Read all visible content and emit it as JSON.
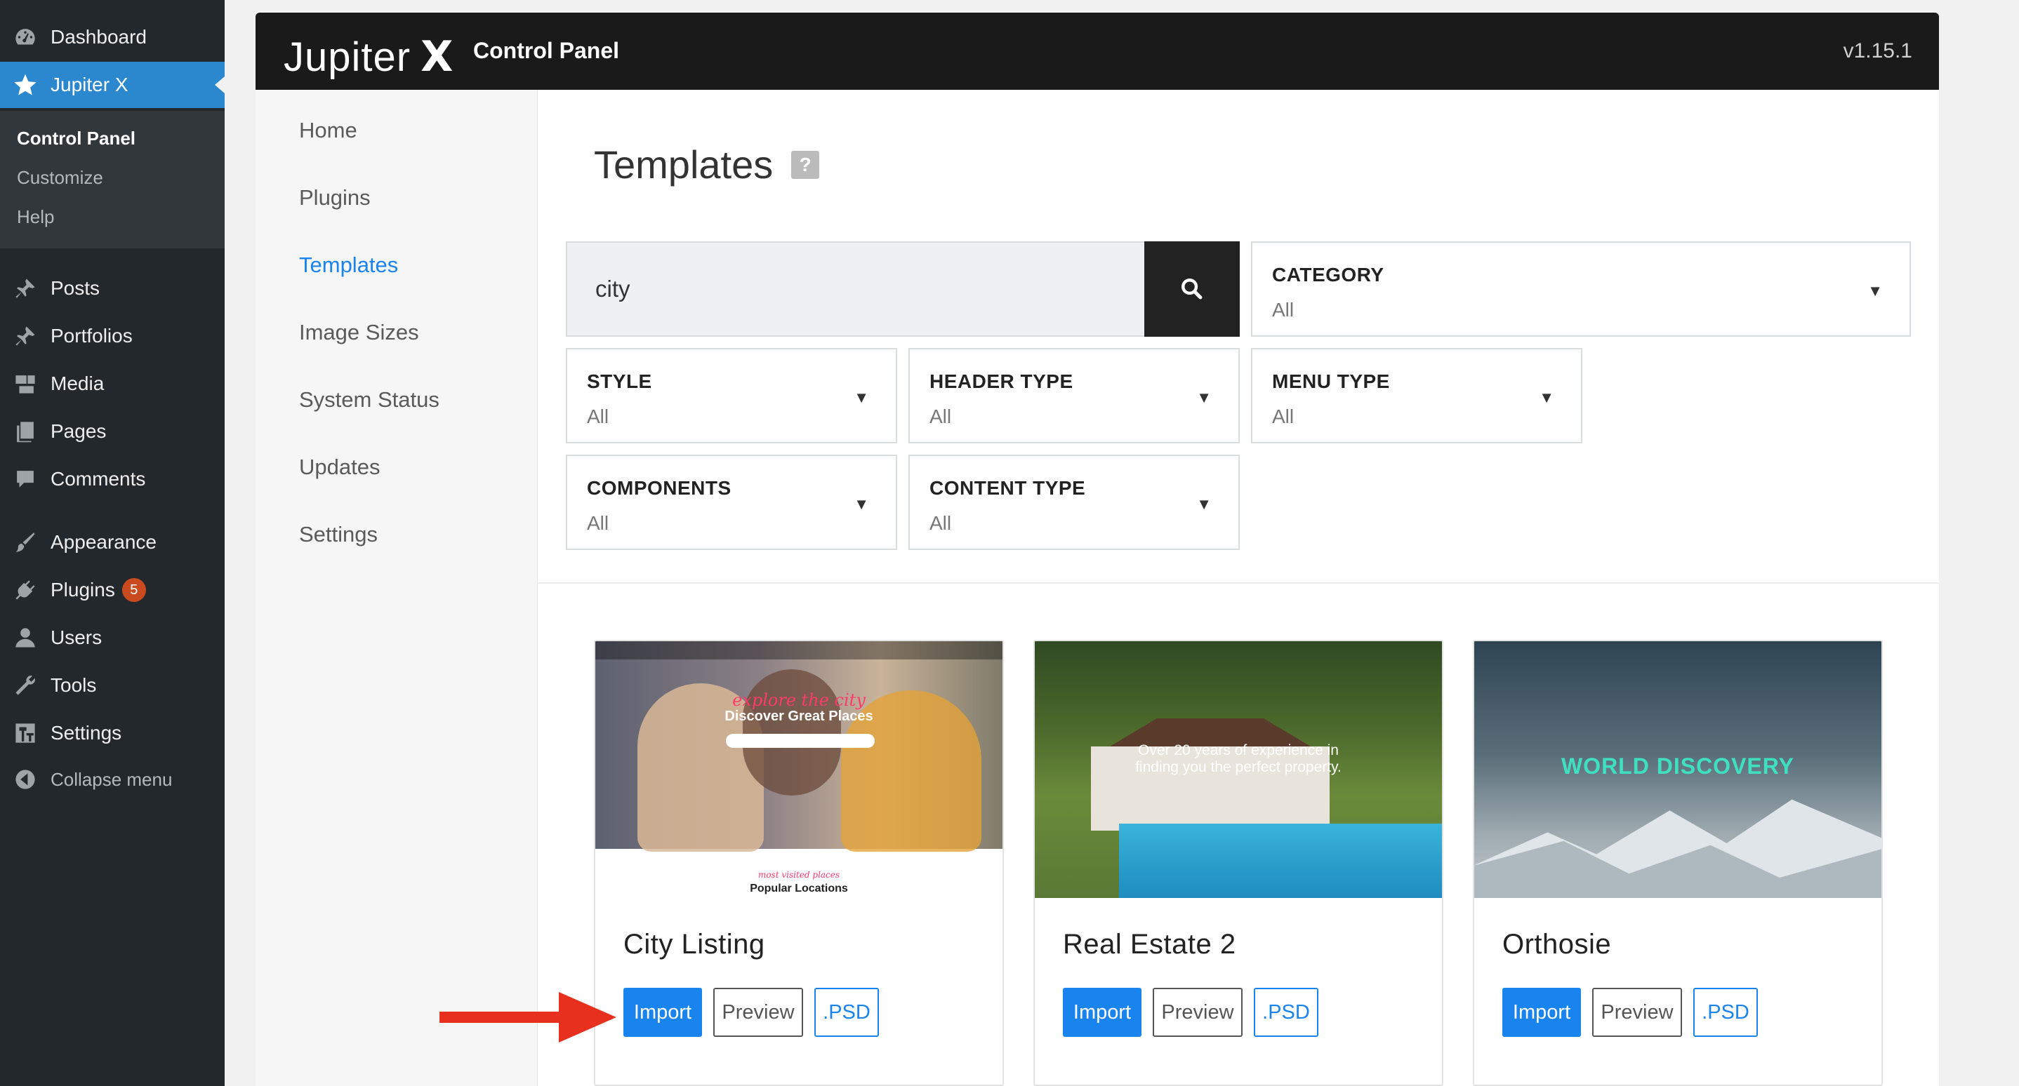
{
  "wp_menu": {
    "dashboard": "Dashboard",
    "jupiterx": "Jupiter X",
    "submenu": [
      "Control Panel",
      "Customize",
      "Help"
    ],
    "posts": "Posts",
    "portfolios": "Portfolios",
    "media": "Media",
    "pages": "Pages",
    "comments": "Comments",
    "appearance": "Appearance",
    "plugins": "Plugins",
    "plugins_badge": "5",
    "users": "Users",
    "tools": "Tools",
    "settings": "Settings",
    "collapse": "Collapse menu"
  },
  "header": {
    "logo_text": "Jupiter",
    "logo_x": "X",
    "title": "Control Panel",
    "version": "v1.15.1"
  },
  "nav": {
    "items": [
      "Home",
      "Plugins",
      "Templates",
      "Image Sizes",
      "System Status",
      "Updates",
      "Settings"
    ],
    "active": "Templates"
  },
  "main": {
    "title": "Templates",
    "help": "?",
    "search_value": "city",
    "filters": {
      "category": {
        "label": "CATEGORY",
        "value": "All"
      },
      "style": {
        "label": "STYLE",
        "value": "All"
      },
      "header_type": {
        "label": "HEADER TYPE",
        "value": "All"
      },
      "menu_type": {
        "label": "MENU TYPE",
        "value": "All"
      },
      "components": {
        "label": "COMPONENTS",
        "value": "All"
      },
      "content_type": {
        "label": "CONTENT TYPE",
        "value": "All"
      }
    }
  },
  "templates": [
    {
      "name": "City Listing",
      "thumb_script": "explore the city",
      "thumb_heading": "Discover Great Places",
      "thumb_sub_script": "most visited places",
      "thumb_sub": "Popular Locations",
      "import": "Import",
      "preview": "Preview",
      "psd": ".PSD"
    },
    {
      "name": "Real Estate 2",
      "thumb_line1": "Over 20 years of experience in",
      "thumb_line2": "finding you the perfect property.",
      "import": "Import",
      "preview": "Preview",
      "psd": ".PSD"
    },
    {
      "name": "Orthosie",
      "thumb_heading": "WORLD DISCOVERY",
      "import": "Import",
      "preview": "Preview",
      "psd": ".PSD"
    }
  ],
  "colors": {
    "accent": "#1a84ee",
    "wp_sidebar": "#23282d",
    "wp_active": "#2b88ce",
    "header_bg": "#1a1a1a",
    "arrow": "#e8301f"
  }
}
